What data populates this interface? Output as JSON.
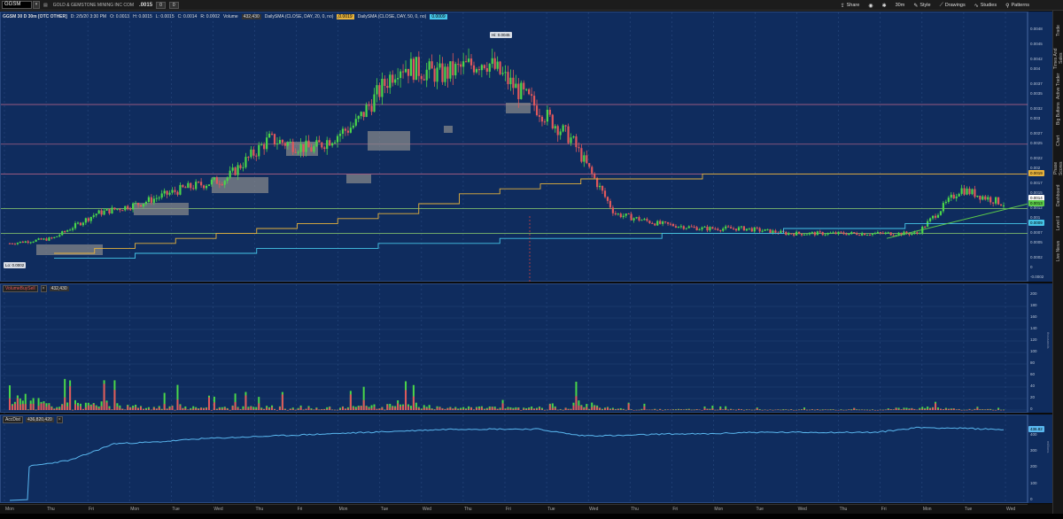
{
  "toolbar": {
    "symbol": "GGSM",
    "company": "GOLD & GEMSTONE MINING INC COM",
    "last": ".0015",
    "price_chip_1": "0",
    "price_chip_2": "0",
    "buttons": [
      {
        "label": "Share",
        "icon": "share-icon"
      },
      {
        "label": "",
        "icon": "camera-icon"
      },
      {
        "label": "",
        "icon": "gear-icon"
      },
      {
        "label": "30m",
        "icon": "timeframe"
      },
      {
        "label": "Style",
        "icon": "style-icon"
      },
      {
        "label": "Drawings",
        "icon": "drawings-icon"
      },
      {
        "label": "Studies",
        "icon": "studies-icon"
      },
      {
        "label": "Patterns",
        "icon": "patterns-icon"
      }
    ]
  },
  "chart_header": {
    "symbol": "GGSM 30 D 30m [OTC OTHER]",
    "date": "D: 2/5/20 3:30 PM",
    "open": "O: 0.0013",
    "high": "H: 0.0015",
    "low": "L: 0.0015",
    "close": "C: 0.0014",
    "change": "R: 0.0002",
    "volume": "Volume",
    "volume_val": "432,430",
    "sma20": "DailySMA (CLOSE, DAY, 20, 0, no)",
    "sma20_val": "0.0019",
    "sma50": "DailySMA (CLOSE, DAY, 50, 0, no)",
    "sma50_val": "0.0009"
  },
  "hi_label": "Hi: 0.0045",
  "lo_label": "Lo: 0.0002",
  "price_axis": {
    "ticks": [
      "0.0048",
      "0.0045",
      "0.0042",
      "0.004",
      "0.0037",
      "0.0035",
      "0.0032",
      "0.003",
      "0.0027",
      "0.0025",
      "0.0022",
      "0.002",
      "0.0017",
      "0.0015",
      "0.0012",
      "0.001",
      "0.0007",
      "0.0005",
      "0.0002",
      "0",
      "-0.0002"
    ],
    "tags": [
      {
        "text": "0.0019",
        "color": "#e6b23c"
      },
      {
        "text": "0.0014",
        "color": "#ffffff"
      },
      {
        "text": "0.0013",
        "color": "#5ccc4a"
      },
      {
        "text": "0.0009",
        "color": "#46c6e8"
      }
    ]
  },
  "volume_study": {
    "name": "VolumeBuySell",
    "value": "432,430",
    "ticks": [
      "200",
      "180",
      "160",
      "140",
      "120",
      "100",
      "80",
      "60",
      "40",
      "20",
      "0"
    ],
    "unit": "thousands"
  },
  "accdist_study": {
    "name": "AccDist",
    "value": "436,820,420",
    "ticks": [
      "400",
      "300",
      "200",
      "100",
      "0"
    ],
    "tag": "436.82",
    "unit": "millions"
  },
  "time_axis": [
    "Mon",
    "Thu",
    "Fri",
    "Mon",
    "Tue",
    "Wed",
    "Thu",
    "Fri",
    "Mon",
    "Tue",
    "Wed",
    "Thu",
    "Fri",
    "Tue",
    "Wed",
    "Thu",
    "Fri",
    "Mon",
    "Tue",
    "Wed",
    "Thu",
    "Fri",
    "Mon",
    "Tue",
    "Wed"
  ],
  "side_tabs": [
    "Trade",
    "Times And Sales",
    "Active Trader",
    "Big Buttons",
    "Chart",
    "Phase Scores",
    "Dashboard",
    "Level II",
    "Live News"
  ],
  "colors": {
    "pane_bg": "#0f2c5e",
    "up": "#4ad64a",
    "down": "#e0585c",
    "sma20": "#e6b23c",
    "sma50": "#46c6e8",
    "trend": "#5ccc4a"
  },
  "chart_data": [
    {
      "type": "line",
      "title": "GGSM 30 D 30m [OTC OTHER]",
      "ylim": [
        -0.0002,
        0.0048
      ],
      "series": [
        {
          "name": "Price",
          "x": [
            "Thu",
            "Fri",
            "Mon",
            "Tue",
            "Wed",
            "Thu",
            "Fri",
            "Mon",
            "Tue",
            "Wed",
            "Thu",
            "Fri",
            "Tue",
            "Wed",
            "Thu",
            "Fri",
            "Mon",
            "Tue",
            "Wed",
            "Thu",
            "Fri",
            "Mon",
            "Tue",
            "Wed"
          ],
          "values": [
            0.0005,
            0.0006,
            0.0011,
            0.0013,
            0.0016,
            0.0018,
            0.0026,
            0.0024,
            0.0029,
            0.0041,
            0.0039,
            0.0042,
            0.0034,
            0.0026,
            0.0011,
            0.0009,
            0.0008,
            0.0008,
            0.0007,
            0.0007,
            0.0007,
            0.0007,
            0.0016,
            0.0013
          ]
        },
        {
          "name": "DailySMA (CLOSE, DAY, 20, 0, no)",
          "values": [
            0.0003,
            0.0004,
            0.0005,
            0.0006,
            0.0007,
            0.0008,
            0.0009,
            0.001,
            0.0011,
            0.0013,
            0.0015,
            0.0016,
            0.0017,
            0.0018,
            0.0018,
            0.0018,
            0.0019,
            0.0019,
            0.0019,
            0.0019,
            0.0019,
            0.0019,
            0.0019,
            0.0019
          ]
        },
        {
          "name": "DailySMA (CLOSE, DAY, 50, 0, no)",
          "values": [
            0.0002,
            0.0002,
            0.0003,
            0.0003,
            0.0003,
            0.0004,
            0.0004,
            0.0004,
            0.0005,
            0.0005,
            0.0005,
            0.0006,
            0.0006,
            0.0006,
            0.0006,
            0.0007,
            0.0007,
            0.0007,
            0.0008,
            0.0008,
            0.0008,
            0.0009,
            0.0009,
            0.0009
          ]
        }
      ]
    },
    {
      "type": "bar",
      "title": "VolumeBuySell",
      "ylim": [
        0,
        200
      ],
      "categories": [
        "Thu",
        "Fri",
        "Mon",
        "Tue",
        "Wed",
        "Thu",
        "Fri",
        "Mon",
        "Tue",
        "Wed",
        "Thu",
        "Fri",
        "Tue",
        "Wed",
        "Thu",
        "Fri",
        "Mon",
        "Tue",
        "Wed",
        "Thu",
        "Fri",
        "Mon",
        "Tue",
        "Wed"
      ],
      "values": [
        190,
        50,
        90,
        40,
        45,
        30,
        40,
        30,
        35,
        70,
        25,
        30,
        20,
        85,
        15,
        10,
        10,
        8,
        6,
        6,
        5,
        30,
        10,
        6
      ]
    },
    {
      "type": "line",
      "title": "AccDist",
      "ylim": [
        0,
        470
      ],
      "x": [
        "Thu",
        "Fri",
        "Mon",
        "Tue",
        "Wed",
        "Thu",
        "Fri",
        "Mon",
        "Tue",
        "Wed",
        "Thu",
        "Fri",
        "Tue",
        "Wed",
        "Thu",
        "Fri",
        "Mon",
        "Tue",
        "Wed",
        "Thu",
        "Fri",
        "Mon",
        "Tue",
        "Wed"
      ],
      "series": [
        {
          "name": "AccDist",
          "values": [
            210,
            250,
            350,
            360,
            380,
            390,
            400,
            410,
            420,
            430,
            440,
            440,
            440,
            400,
            400,
            410,
            410,
            420,
            420,
            420,
            420,
            450,
            445,
            436.82
          ]
        }
      ]
    }
  ]
}
